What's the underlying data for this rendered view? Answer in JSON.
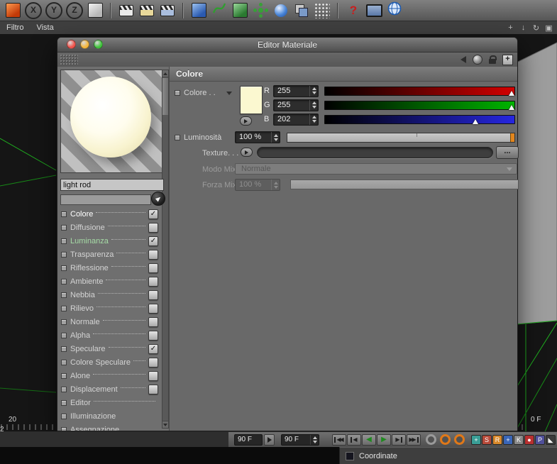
{
  "top_toolbar": {
    "icons": [
      {
        "name": "app-cube-icon",
        "kind": "cube",
        "hl": "#ff9a50",
        "bg": "#c23a08"
      },
      {
        "name": "x-axis-lock-icon",
        "kind": "letter",
        "glyph": "X"
      },
      {
        "name": "y-axis-lock-icon",
        "kind": "letter",
        "glyph": "Y"
      },
      {
        "name": "z-axis-lock-icon",
        "kind": "letter",
        "glyph": "Z"
      },
      {
        "name": "coordinate-system-icon",
        "kind": "cube",
        "hl": "#f2f2f2",
        "bg": "#b8b8b8",
        "sep_after": true
      },
      {
        "name": "render-view-icon",
        "kind": "clapper"
      },
      {
        "name": "render-picture-viewer-icon",
        "kind": "clapper",
        "accent": "#e8d89a"
      },
      {
        "name": "render-settings-icon",
        "kind": "clapper",
        "accent": "#aabede",
        "sep_after": true
      },
      {
        "name": "add-cube-object-icon",
        "kind": "cube",
        "hl": "#9cc2f0",
        "bg": "#2a5ab0"
      },
      {
        "name": "add-spline-icon",
        "kind": "spline"
      },
      {
        "name": "add-generator-icon",
        "kind": "cube",
        "hl": "#9ad89a",
        "bg": "#2a7a30"
      },
      {
        "name": "add-array-icon",
        "kind": "flower"
      },
      {
        "name": "add-metaball-icon",
        "kind": "meta"
      },
      {
        "name": "add-boolean-icon",
        "kind": "bool"
      },
      {
        "name": "add-particles-icon",
        "kind": "dots",
        "sep_after": true
      },
      {
        "name": "help-icon",
        "kind": "glyph",
        "glyph": "?",
        "fg": "#c81e1e",
        "bold": true
      },
      {
        "name": "display-settings-icon",
        "kind": "screen"
      },
      {
        "name": "online-globe-icon",
        "kind": "globe"
      }
    ]
  },
  "menubar": {
    "items": [
      "Filtro",
      "Vista"
    ],
    "view_icons": [
      {
        "name": "pan-view-icon",
        "glyph": "+"
      },
      {
        "name": "dolly-view-icon",
        "glyph": "↓"
      },
      {
        "name": "rotate-view-icon",
        "glyph": "↻"
      },
      {
        "name": "toggle-view-icon",
        "glyph": "▣"
      }
    ]
  },
  "viewport": {
    "ruler": {
      "label_20": "20",
      "label_2": "2",
      "label_right": "0 F"
    }
  },
  "material_editor": {
    "title": "Editor Materiale",
    "traffic_lights": [
      {
        "name": "close-button",
        "color": "#f2544c"
      },
      {
        "name": "minimize-button",
        "color": "#f6b73c"
      },
      {
        "name": "zoom-button",
        "color": "#41c63c"
      }
    ],
    "window_nav": [
      {
        "name": "nav-back-icon",
        "kind": "tri-left"
      },
      {
        "name": "material-sphere-icon",
        "kind": "sphere"
      },
      {
        "name": "lock-icon",
        "kind": "lock"
      },
      {
        "name": "new-tab-icon",
        "kind": "plus",
        "glyph": "+"
      }
    ],
    "material_name": "light rod",
    "channels": [
      {
        "label": "Colore",
        "dots": true,
        "check": "on",
        "selected": true
      },
      {
        "label": "Diffusione",
        "dots": true,
        "check": "off"
      },
      {
        "label": "Luminanza",
        "dots": true,
        "check": "on",
        "tint": true
      },
      {
        "label": "Trasparenza",
        "dots": true,
        "check": "off"
      },
      {
        "label": "Riflessione",
        "dots": true,
        "check": "off"
      },
      {
        "label": "Ambiente",
        "dots": true,
        "check": "off"
      },
      {
        "label": "Nebbia",
        "dots": true,
        "check": "off"
      },
      {
        "label": "Rilievo",
        "dots": true,
        "check": "off"
      },
      {
        "label": "Normale",
        "dots": true,
        "check": "off"
      },
      {
        "label": "Alpha",
        "dots": true,
        "check": "off"
      },
      {
        "label": "Speculare",
        "dots": true,
        "check": "on"
      },
      {
        "label": "Colore Speculare",
        "dots": true,
        "check": "off"
      },
      {
        "label": "Alone",
        "dots": true,
        "check": "off"
      },
      {
        "label": "Displacement",
        "dots": true,
        "check": "off"
      },
      {
        "label": "Editor",
        "dots": true,
        "check": "none"
      },
      {
        "label": "Illuminazione",
        "dots": false,
        "check": "none"
      },
      {
        "label": "Assegnazione",
        "dots": false,
        "check": "none"
      }
    ],
    "color_page": {
      "header": "Colore",
      "color_label": "Colore . .",
      "swatch_hex": "#fbf8d0",
      "rgb": [
        {
          "label": "R",
          "value": "255",
          "bar": "#d40000"
        },
        {
          "label": "G",
          "value": "255",
          "bar": "#00b400"
        },
        {
          "label": "B",
          "value": "202",
          "bar": "#2626e0"
        }
      ],
      "brightness_label": "Luminosità",
      "brightness_value": "100 %",
      "texture_label": "Texture. . .",
      "texture_more": "...",
      "mix_mode_label": "Modo Mix",
      "mix_mode_value": "Normale",
      "mix_strength_label": "Forza Mix",
      "mix_strength_value": "100 %"
    }
  },
  "timeline": {
    "frame_field": "90 F",
    "range_field": "90 F",
    "transport": [
      {
        "name": "goto-start-button",
        "glyph": "◀◀",
        "bar": "left"
      },
      {
        "name": "previous-frame-button",
        "glyph": "◀",
        "bar": "left"
      },
      {
        "name": "play-backwards-button",
        "glyph": "◀",
        "green": true
      },
      {
        "name": "play-forwards-button",
        "glyph": "▶",
        "green": true
      },
      {
        "name": "next-frame-button",
        "glyph": "▶",
        "bar": "right"
      },
      {
        "name": "goto-end-button",
        "glyph": "▶▶",
        "bar": "right"
      }
    ],
    "record_icons": [
      {
        "name": "record-active-objects-icon",
        "ring": "#9a9a9a"
      },
      {
        "name": "autokeying-icon",
        "ring": "#e07818"
      },
      {
        "name": "keyframe-selection-icon",
        "ring": "#e07818"
      }
    ],
    "key_icons": [
      {
        "name": "position-key-icon",
        "bg": "#3a9e96",
        "glyph": "+"
      },
      {
        "name": "scale-key-icon",
        "bg": "#b84a3a",
        "glyph": "S"
      },
      {
        "name": "rotation-key-icon",
        "bg": "#d8882a",
        "glyph": "R"
      },
      {
        "name": "parameter-key-icon",
        "bg": "#3a66b8",
        "glyph": "+"
      },
      {
        "name": "pla-key-icon",
        "bg": "#8a8a8a",
        "glyph": "K"
      },
      {
        "name": "record-key-icon",
        "bg": "#b83030",
        "glyph": "●"
      },
      {
        "name": "play-prefs-icon",
        "bg": "#50509a",
        "glyph": "P"
      },
      {
        "name": "minimize-panel-icon",
        "bg": "#3a3a3a",
        "glyph": "◣"
      }
    ]
  },
  "coordinate_panel": {
    "title": "Coordinate"
  }
}
